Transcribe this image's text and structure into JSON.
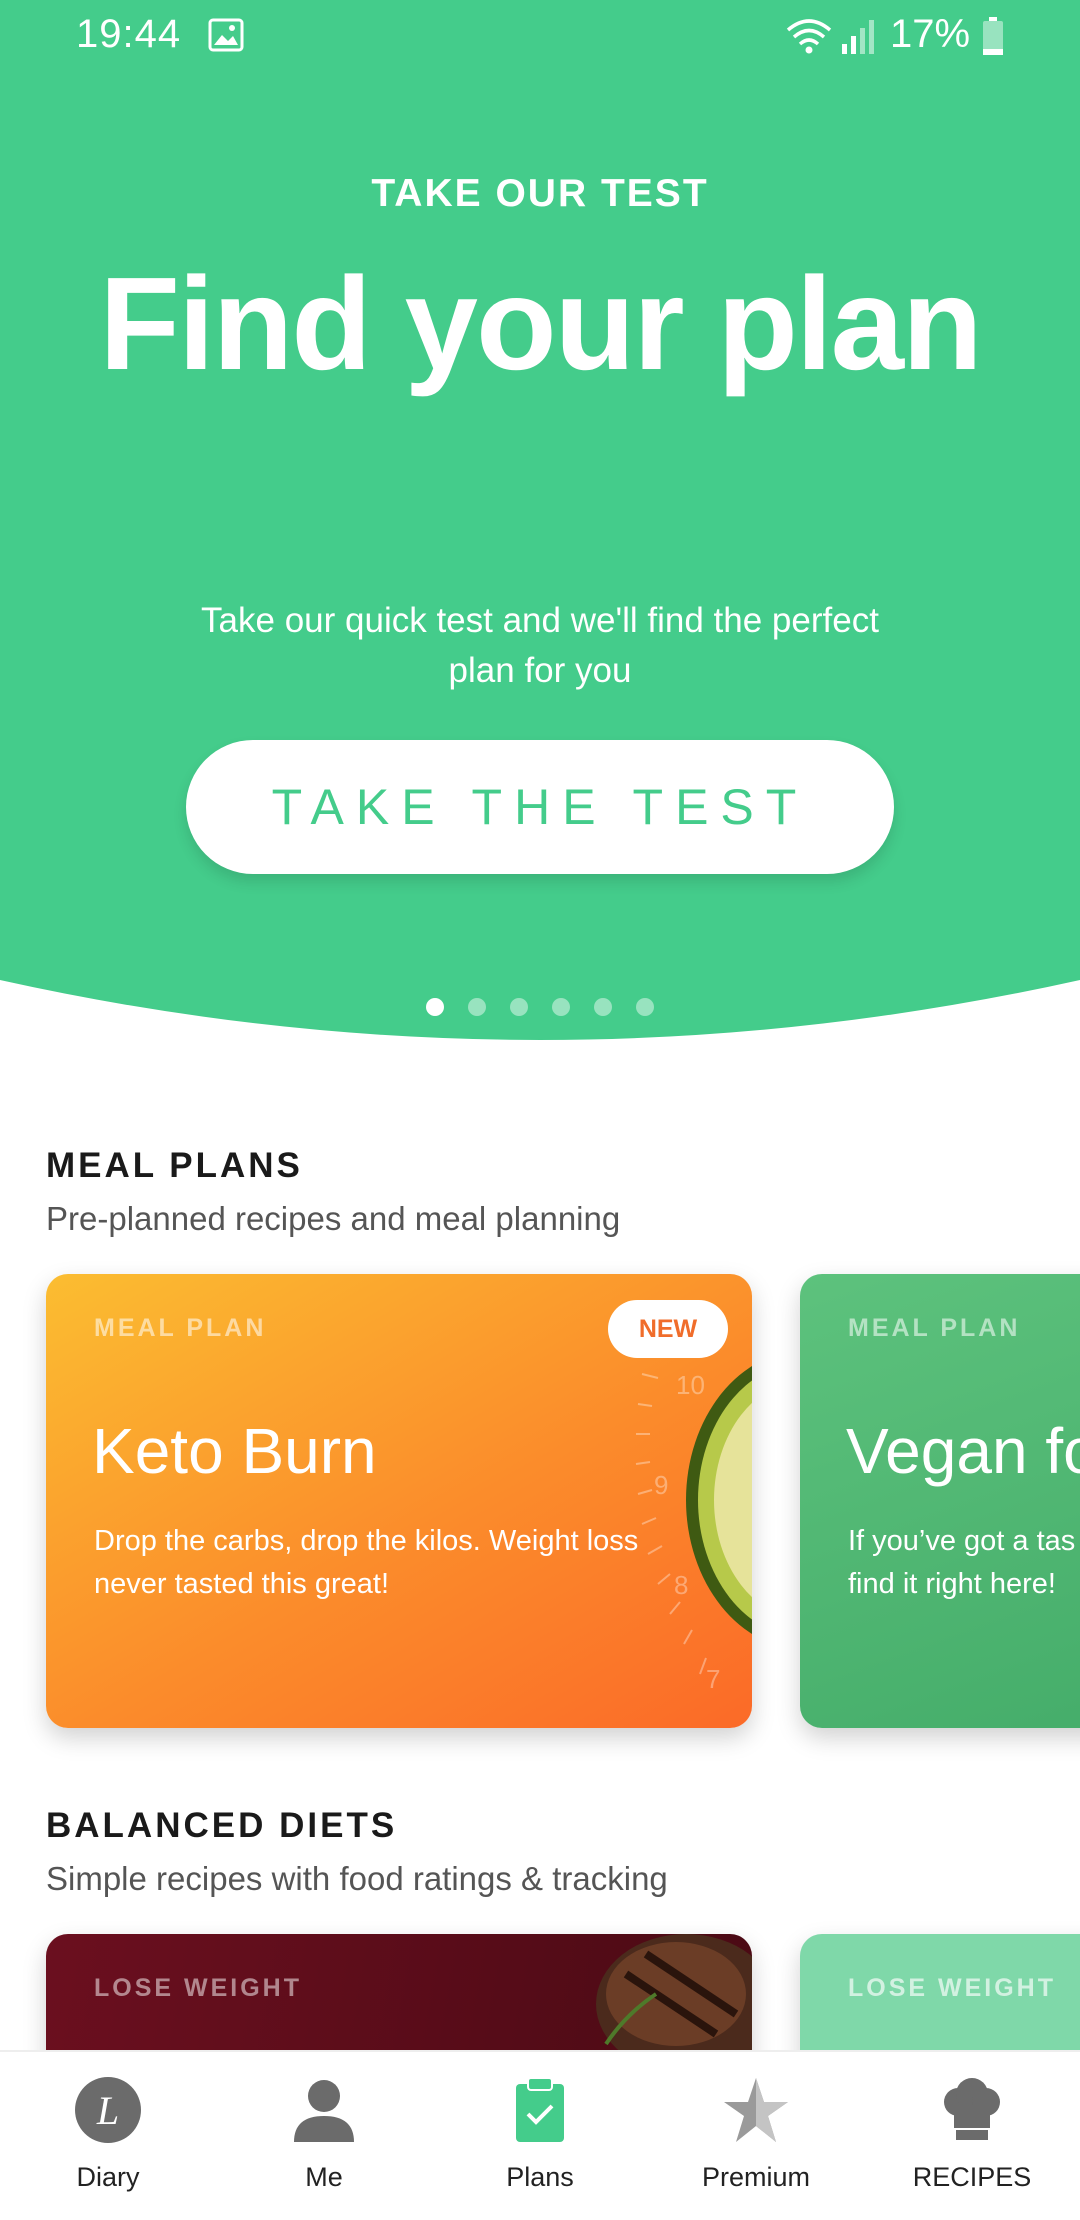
{
  "status_bar": {
    "time": "19:44",
    "battery": "17%",
    "icons": [
      "image-icon",
      "wifi-icon",
      "signal-icon",
      "battery-icon"
    ]
  },
  "hero": {
    "kicker": "TAKE OUR TEST",
    "title": "Find your plan",
    "subtitle": "Take our quick test and we'll find the perfect plan for you",
    "button_label": "TAKE THE TEST",
    "carousel": {
      "count": 6,
      "active_index": 0
    }
  },
  "meal_plans": {
    "title": "MEAL PLANS",
    "subtitle": "Pre-planned recipes and meal planning",
    "cards": [
      {
        "kicker": "MEAL PLAN",
        "badge": "NEW",
        "title": "Keto Burn",
        "description": "Drop the carbs, drop the kilos. Weight loss never tasted this great!"
      },
      {
        "kicker": "MEAL PLAN",
        "title": "Vegan fo",
        "description_line1": "If you’ve got a tas",
        "description_line2": "find it right here!"
      }
    ]
  },
  "balanced_diets": {
    "title": "BALANCED DIETS",
    "subtitle": "Simple recipes with food ratings & tracking",
    "cards": [
      {
        "kicker": "LOSE WEIGHT"
      },
      {
        "kicker": "LOSE WEIGHT"
      }
    ]
  },
  "bottom_nav": {
    "items": [
      {
        "label": "Diary",
        "icon": "diary-icon"
      },
      {
        "label": "Me",
        "icon": "person-icon"
      },
      {
        "label": "Plans",
        "icon": "clipboard-check-icon",
        "active": true
      },
      {
        "label": "Premium",
        "icon": "star-icon"
      },
      {
        "label": "RECIPES",
        "icon": "chef-hat-icon"
      }
    ]
  },
  "colors": {
    "accent": "#44cc8b",
    "keto_start": "#fbbd31",
    "keto_end": "#fb6a28",
    "vegan": "#45ad6a",
    "badge_text": "#f06d2b"
  }
}
